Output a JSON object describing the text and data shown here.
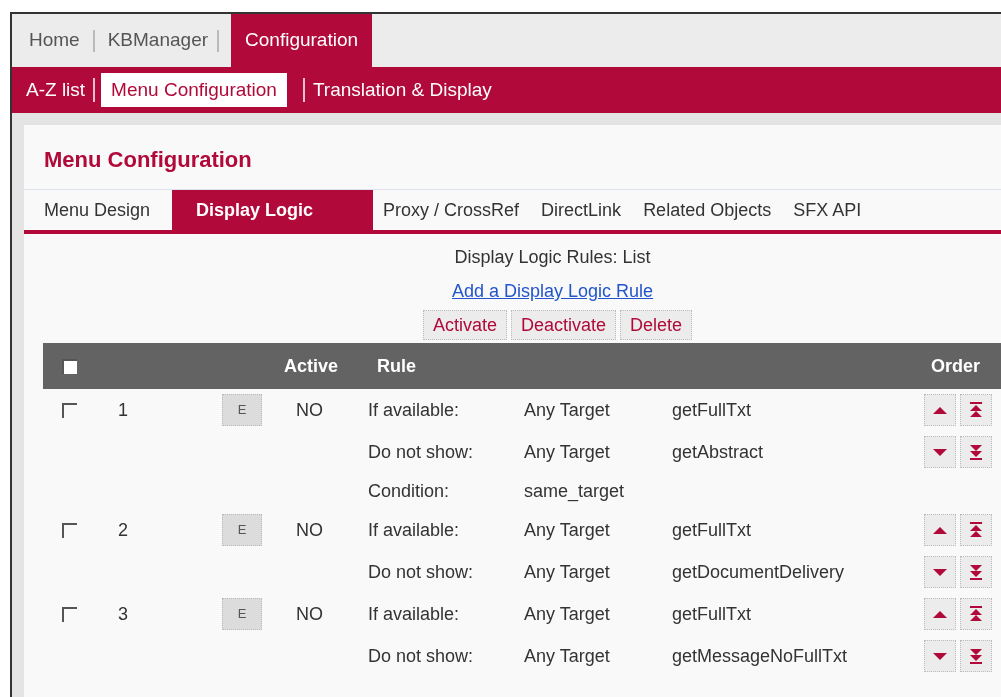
{
  "top_nav": [
    {
      "label": "Home",
      "selected": false
    },
    {
      "label": "KBManager",
      "selected": false
    },
    {
      "label": "Configuration",
      "selected": true
    }
  ],
  "sub_nav": [
    {
      "label": "A-Z list",
      "selected": false
    },
    {
      "label": "Menu Configuration",
      "selected": true
    },
    {
      "label": "Translation & Display",
      "selected": false
    }
  ],
  "page_title": "Menu Configuration",
  "tabs": [
    {
      "label": "Menu Design",
      "selected": false
    },
    {
      "label": "Display Logic",
      "selected": true
    },
    {
      "label": "Proxy / CrossRef",
      "selected": false
    },
    {
      "label": "DirectLink",
      "selected": false
    },
    {
      "label": "Related Objects",
      "selected": false
    },
    {
      "label": "SFX API",
      "selected": false
    }
  ],
  "list_title": "Display Logic Rules: List",
  "add_link": "Add a Display Logic Rule",
  "actions": [
    "Activate",
    "Deactivate",
    "Delete"
  ],
  "table": {
    "header_checked": false,
    "columns": [
      "Active",
      "Rule",
      "Order"
    ],
    "rows": [
      {
        "checked": false,
        "number": "1",
        "edit": "E",
        "active": "NO",
        "lines": [
          {
            "kind": "available",
            "label": "If available:",
            "target": "Any Target",
            "service": "getFullTxt"
          },
          {
            "kind": "hide",
            "label": "Do not show:",
            "target": "Any Target",
            "service": "getAbstract"
          },
          {
            "kind": "condition",
            "label": "Condition:",
            "target": "same_target"
          }
        ]
      },
      {
        "checked": false,
        "number": "2",
        "edit": "E",
        "active": "NO",
        "lines": [
          {
            "kind": "available",
            "label": "If available:",
            "target": "Any Target",
            "service": "getFullTxt"
          },
          {
            "kind": "hide",
            "label": "Do not show:",
            "target": "Any Target",
            "service": "getDocumentDelivery"
          }
        ]
      },
      {
        "checked": false,
        "number": "3",
        "edit": "E",
        "active": "NO",
        "lines": [
          {
            "kind": "available",
            "label": "If available:",
            "target": "Any Target",
            "service": "getFullTxt"
          },
          {
            "kind": "hide",
            "label": "Do not show:",
            "target": "Any Target",
            "service": "getMessageNoFullTxt"
          }
        ]
      }
    ]
  }
}
